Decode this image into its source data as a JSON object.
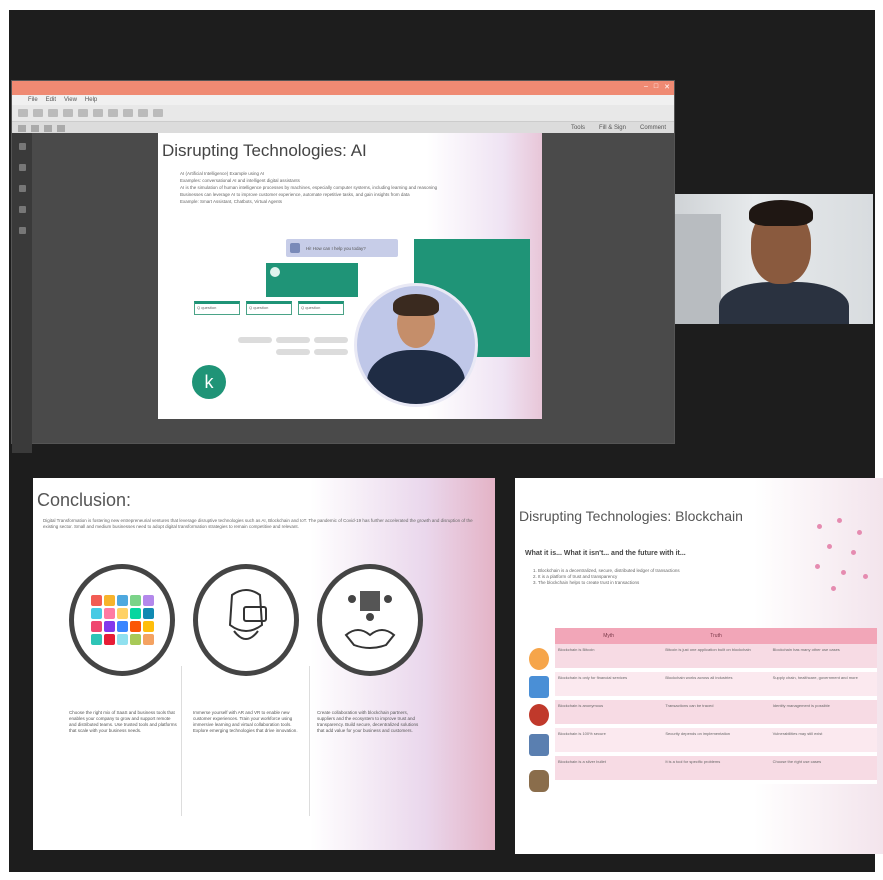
{
  "pdf_window": {
    "title": "",
    "menus": [
      "File",
      "Edit",
      "View",
      "Help"
    ],
    "toolbar_right": [
      "Tools",
      "Fill & Sign",
      "Comment"
    ]
  },
  "slide_ai": {
    "title": "Disrupting Technologies: AI",
    "lines": [
      "AI (Artificial Intelligence) Example using AI",
      "Examples: conversational AI and intelligent digital assistants",
      "AI is the simulation of human intelligence processes by machines, especially computer systems, including learning and reasoning",
      "Businesses can leverage AI to improve customer experience, automate repetitive tasks, and gain insights from data",
      "Example: Smart Assistant, Chatbots, Virtual Agents"
    ],
    "chat_text": "Hi! How can I help you today?",
    "mini_boxes": [
      "Q question",
      "Q question",
      "Q question"
    ],
    "logo_letter": "k"
  },
  "slide_conclusion": {
    "title": "Conclusion:",
    "body": "Digital Transformation is fostering new entrepreneurial ventures that leverage disruptive technologies such as AI, Blockchain and IoT. The pandemic of Covid-19 has further accelerated the growth and disruption of the existing sector. Small and medium businesses need to adopt digital transformation strategies to remain competitive and relevant.",
    "columns": [
      "Choose the right mix of SaaS and business tools that enables your company to grow and support remote and distributed teams. Use trusted tools and platforms that scale with your business needs.",
      "Immerse yourself with AR and VR to enable new customer experiences. Train your workforce using immersive learning and virtual collaboration tools. Explore emerging technologies that drive innovation.",
      "Create collaboration with blockchain partners, suppliers and the ecosystem to improve trust and transparency. Build secure, decentralized solutions that add value for your business and customers."
    ]
  },
  "slide_blockchain": {
    "title": "Disrupting Technologies: Blockchain",
    "subtitle": "What it is... What it isn't... and the future with it...",
    "list": [
      "1. Blockchain is a decentralized, secure, distributed ledger of transactions",
      "2. It is a platform of trust and transparency",
      "3. The blockchain helps to create trust in transactions"
    ],
    "table": {
      "headers": [
        "Myth",
        "Truth"
      ],
      "rows": [
        [
          "Blockchain is Bitcoin",
          "Bitcoin is just one application built on blockchain",
          "Blockchain has many other use cases"
        ],
        [
          "Blockchain is only for financial services",
          "Blockchain works across all industries",
          "Supply chain, healthcare, government and more"
        ],
        [
          "Blockchain is anonymous",
          "Transactions can be traced",
          "Identity management is possible"
        ],
        [
          "Blockchain is 100% secure",
          "Security depends on implementation",
          "Vulnerabilities may still exist"
        ],
        [
          "Blockchain is a silver bullet",
          "It is a tool for specific problems",
          "Choose the right use cases"
        ]
      ]
    }
  }
}
